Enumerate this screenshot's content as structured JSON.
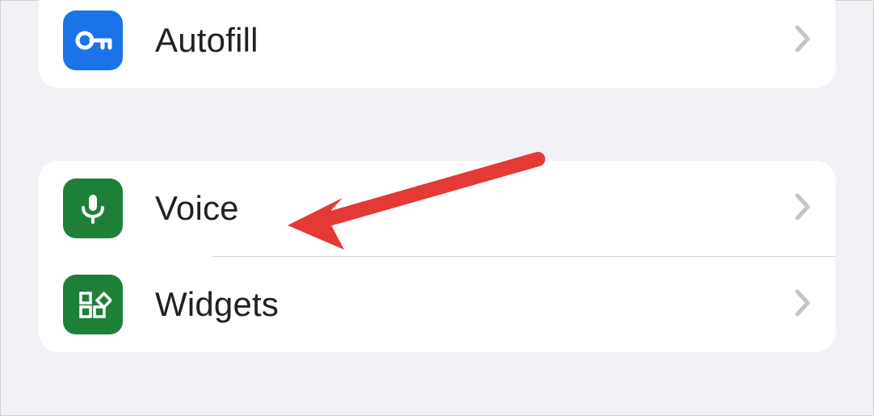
{
  "group1": {
    "items": [
      {
        "label": "Autofill",
        "icon": "key",
        "color": "blue"
      }
    ]
  },
  "group2": {
    "items": [
      {
        "label": "Voice",
        "icon": "microphone",
        "color": "green"
      },
      {
        "label": "Widgets",
        "icon": "widgets",
        "color": "green"
      }
    ]
  },
  "annotation": {
    "target": "Voice",
    "color": "#E53935"
  }
}
